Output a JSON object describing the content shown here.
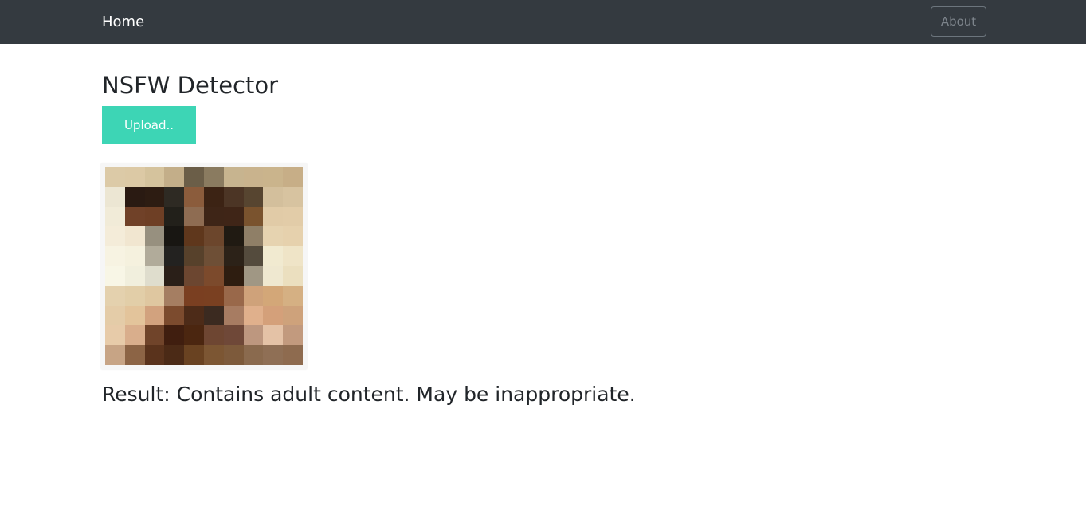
{
  "navbar": {
    "brand_label": "Home",
    "about_label": "About"
  },
  "main": {
    "title": "NSFW Detector",
    "upload_label": "Upload..",
    "result_text": "Result: Contains adult content. May be inappropriate."
  },
  "image": {
    "description_icon": "pixelated-image",
    "palette": [
      "#dccaa7",
      "#dcc9a5",
      "#d5c39d",
      "#c3ae89",
      "#6b5e48",
      "#8a7b60",
      "#c7b48f",
      "#c9b38d",
      "#cab48c",
      "#c7ae87",
      "#ece6d3",
      "#2a1a12",
      "#2d1c12",
      "#2e2a23",
      "#8b5c3c",
      "#3c2314",
      "#4c3525",
      "#574530",
      "#d3bf9c",
      "#d7c3a0",
      "#f1ebd8",
      "#704128",
      "#6e3f25",
      "#22201a",
      "#8e6c52",
      "#3e2517",
      "#3f2517",
      "#7a532e",
      "#e1cba7",
      "#e2cca8",
      "#f4ecd9",
      "#f1e6d0",
      "#97907f",
      "#181612",
      "#5f371c",
      "#6c462c",
      "#201a12",
      "#8f7f67",
      "#e6d3b0",
      "#e6d1ad",
      "#f7f3e2",
      "#f5f1de",
      "#b1ab9a",
      "#232220",
      "#57412b",
      "#6e4f36",
      "#2c2218",
      "#544b3d",
      "#f1ead0",
      "#efe4c7",
      "#f8f6e6",
      "#f1efdd",
      "#dfddcd",
      "#2a1f18",
      "#6c4630",
      "#7c4a2c",
      "#2e1d10",
      "#a09784",
      "#efe8d0",
      "#ebdfbf",
      "#e4d1ae",
      "#e2cea8",
      "#dfc7a0",
      "#a57e62",
      "#7a3f21",
      "#7a4021",
      "#99684a",
      "#cfa27a",
      "#d3a778",
      "#d5b083",
      "#e4cca8",
      "#e3c49b",
      "#d2a27e",
      "#7c4b2e",
      "#4d2b18",
      "#3b2a20",
      "#a77c62",
      "#e0b08c",
      "#d4a07a",
      "#cea27b",
      "#e7cba9",
      "#d9ae8c",
      "#70442a",
      "#401e0f",
      "#4b2610",
      "#6e4632",
      "#6f4838",
      "#bd977f",
      "#e4c2a6",
      "#c29a7e",
      "#c7a485",
      "#8c6445",
      "#5a331c",
      "#4b2a16",
      "#694221",
      "#7c5633",
      "#7d5a3b",
      "#8a6a4e",
      "#8f6f55",
      "#8e6b4f"
    ]
  }
}
